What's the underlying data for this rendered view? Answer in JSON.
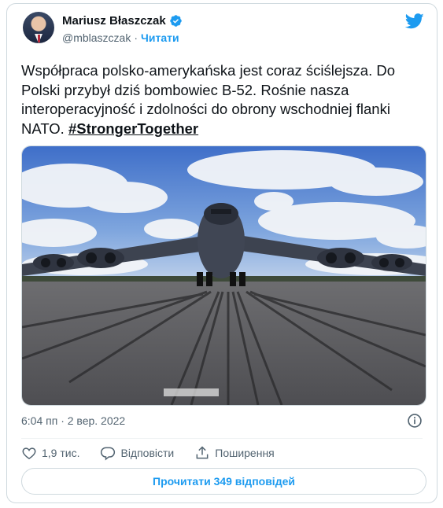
{
  "author": {
    "name": "Mariusz Błaszczak",
    "handle": "@mblaszczak",
    "separator": "·",
    "follow_label": "Читати"
  },
  "tweet": {
    "text_main": "Współpraca polsko-amerykańska jest coraz ściślejsza. Do Polski przybył dziś bombowiec B-52. Rośnie nasza interoperacyjność i zdolności do obrony wschodniej flanki NATO. ",
    "hashtag": "#StrongerTogether",
    "timestamp": "6:04 пп · 2 вер. 2022"
  },
  "actions": {
    "like_count": "1,9 тис.",
    "reply_label": "Відповісти",
    "share_label": "Поширення"
  },
  "read_replies_label": "Прочитати 349 відповідей",
  "colors": {
    "accent": "#1d9bf0",
    "text": "#0f1419",
    "muted": "#536471"
  },
  "icons": [
    "verified-badge-icon",
    "twitter-bird-icon",
    "info-icon",
    "heart-icon",
    "reply-icon",
    "share-icon"
  ]
}
